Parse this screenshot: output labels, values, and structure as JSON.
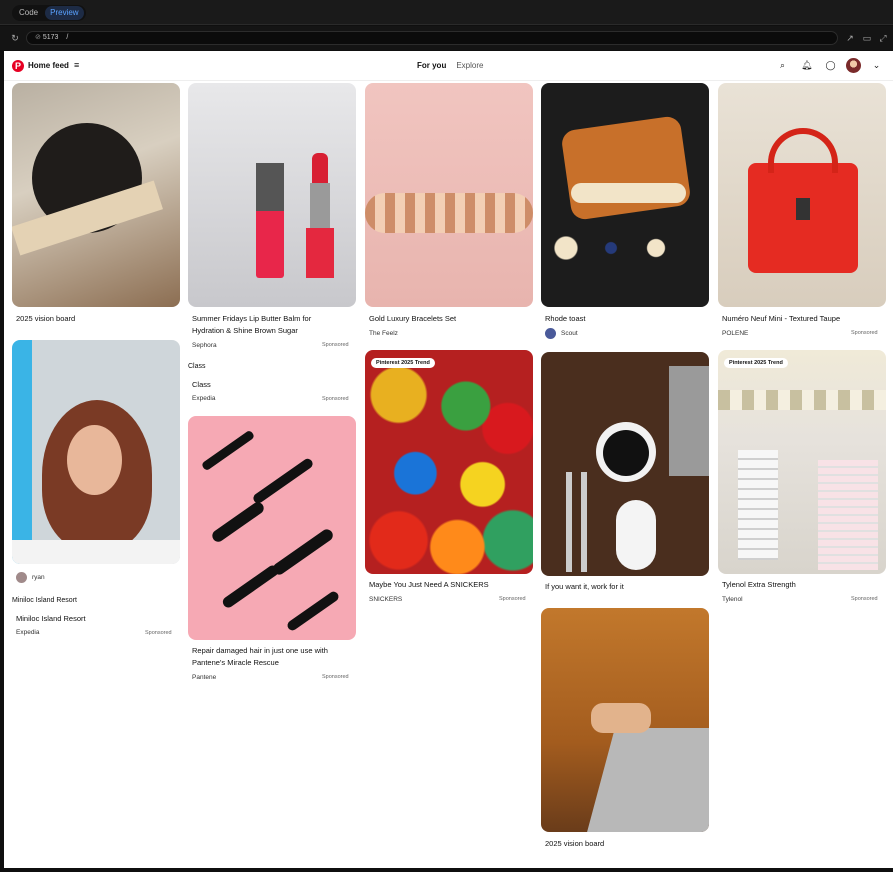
{
  "ide": {
    "tab_code": "Code",
    "tab_preview": "Preview",
    "port": "5173",
    "path": "/"
  },
  "header": {
    "home_feed": "Home feed",
    "tab_for_you": "For you",
    "tab_explore": "Explore"
  },
  "pins": {
    "p1": {
      "title": "2025 vision board"
    },
    "p2": {
      "title_line1": "Summer Fridays Lip Butter Balm for",
      "title_line2": "Hydration & Shine Brown Sugar",
      "source": "Sephora",
      "sponsored": "Sponsored"
    },
    "p3": {
      "title": "Gold Luxury Bracelets Set",
      "source": "The Feelz"
    },
    "p4": {
      "title": "Rhode toast",
      "user": "Scout"
    },
    "p5": {
      "title": "Numéro Neuf Mini - Textured Taupe",
      "source": "POLENE",
      "sponsored": "Sponsored"
    },
    "p6": {
      "user": "ryan"
    },
    "p7": {
      "alt": "Miniloc Island Resort",
      "title": "Miniloc Island Resort",
      "source": "Expedia",
      "sponsored": "Sponsored"
    },
    "p8": {
      "alt": "Class",
      "title": "Class",
      "source": "Expedia",
      "sponsored": "Sponsored"
    },
    "p9": {
      "title_line1": "Repair damaged hair in just one use with",
      "title_line2": "Pantene's Miracle Rescue",
      "source": "Pantene",
      "sponsored": "Sponsored"
    },
    "p10": {
      "badge": "Pinterest 2025 Trend",
      "title": "Maybe You Just Need A SNICKERS",
      "source": "SNICKERS",
      "sponsored": "Sponsored"
    },
    "p11": {
      "title": "If you want it, work for it"
    },
    "p12": {
      "badge": "Pinterest 2025 Trend",
      "title": "Tylenol Extra Strength",
      "source": "Tylenol",
      "sponsored": "Sponsored"
    },
    "p13": {
      "title": "2025 vision board"
    }
  }
}
